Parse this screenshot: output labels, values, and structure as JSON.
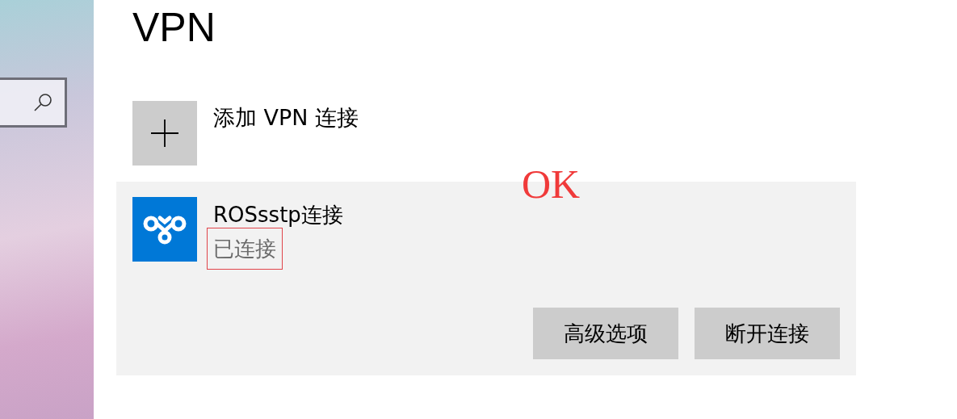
{
  "page": {
    "title": "VPN"
  },
  "add_vpn": {
    "label": "添加 VPN 连接"
  },
  "connections": [
    {
      "name": "ROSsstp连接",
      "status": "已连接",
      "highlighted": true,
      "buttons": [
        "高级选项",
        "断开连接"
      ]
    }
  ],
  "annotation": {
    "text": "OK"
  }
}
